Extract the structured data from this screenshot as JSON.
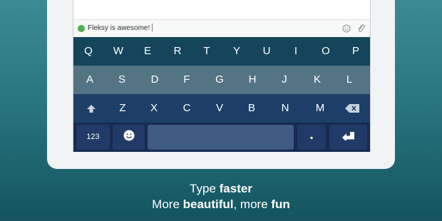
{
  "compose": {
    "text": "Fleksy is awesome!"
  },
  "keyboard": {
    "row1": [
      "Q",
      "W",
      "E",
      "R",
      "T",
      "Y",
      "U",
      "I",
      "O",
      "P"
    ],
    "row2": [
      "A",
      "S",
      "D",
      "F",
      "G",
      "H",
      "J",
      "K",
      "L"
    ],
    "row3": [
      "Z",
      "X",
      "C",
      "V",
      "B",
      "N",
      "M"
    ],
    "numbers_label": "123",
    "period_label": ".",
    "icons": [
      "shift-icon",
      "backspace-icon",
      "emoji-icon",
      "enter-icon",
      "attach-icon"
    ]
  },
  "tagline": {
    "line1_a": "Type ",
    "line1_b": "faster",
    "line2_a": "More ",
    "line2_b": "beautiful",
    "line2_c": ", more ",
    "line2_d": "fun"
  },
  "colors": {
    "background_top": "#3b8a92",
    "background_bottom": "#13545f",
    "row1": "#14455b",
    "row2": "#547483",
    "row3": "#1d3f67",
    "row4": "#172a51",
    "status_dot": "#4caf50"
  }
}
